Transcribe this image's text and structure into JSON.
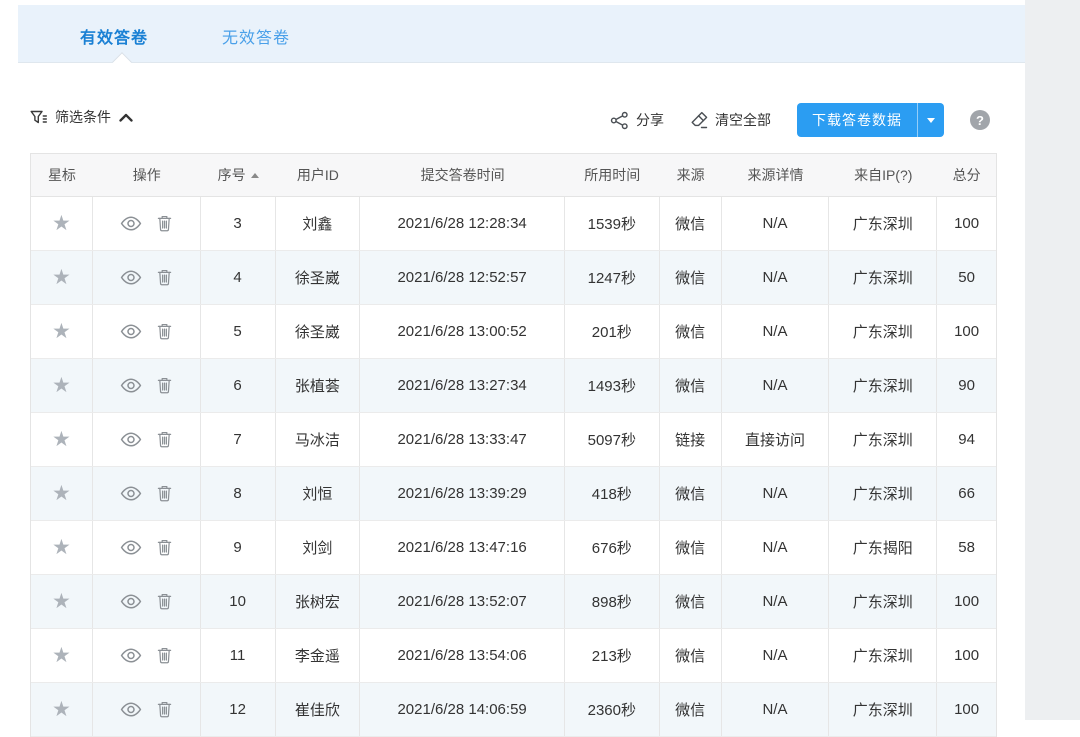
{
  "tabs": {
    "valid": "有效答卷",
    "invalid": "无效答卷"
  },
  "toolbar": {
    "filter": "筛选条件",
    "share": "分享",
    "clear_all": "清空全部",
    "download": "下载答卷数据",
    "help": "?"
  },
  "icons": {
    "star": "★"
  },
  "colors": {
    "accent": "#2b9df2",
    "active_tab": "#1a80d4",
    "inactive_tab": "#4aa0e9",
    "tabbar_bg": "#e9f2fb",
    "stripe": "#f2f7fa"
  },
  "table": {
    "headers": [
      "星标",
      "操作",
      "序号",
      "用户ID",
      "提交答卷时间",
      "所用时间",
      "来源",
      "来源详情",
      "来自IP(?)",
      "总分"
    ],
    "sorted_column": "序号",
    "sort_direction": "asc",
    "rows": [
      {
        "seq": "3",
        "user": "刘鑫",
        "time": "2021/6/28 12:28:34",
        "duration": "1539秒",
        "source": "微信",
        "source_detail": "N/A",
        "ip": "广东深圳",
        "score": "100"
      },
      {
        "seq": "4",
        "user": "徐圣崴",
        "time": "2021/6/28 12:52:57",
        "duration": "1247秒",
        "source": "微信",
        "source_detail": "N/A",
        "ip": "广东深圳",
        "score": "50"
      },
      {
        "seq": "5",
        "user": "徐圣崴",
        "time": "2021/6/28 13:00:52",
        "duration": "201秒",
        "source": "微信",
        "source_detail": "N/A",
        "ip": "广东深圳",
        "score": "100"
      },
      {
        "seq": "6",
        "user": "张植荟",
        "time": "2021/6/28 13:27:34",
        "duration": "1493秒",
        "source": "微信",
        "source_detail": "N/A",
        "ip": "广东深圳",
        "score": "90"
      },
      {
        "seq": "7",
        "user": "马冰洁",
        "time": "2021/6/28 13:33:47",
        "duration": "5097秒",
        "source": "链接",
        "source_detail": "直接访问",
        "ip": "广东深圳",
        "score": "94"
      },
      {
        "seq": "8",
        "user": "刘恒",
        "time": "2021/6/28 13:39:29",
        "duration": "418秒",
        "source": "微信",
        "source_detail": "N/A",
        "ip": "广东深圳",
        "score": "66"
      },
      {
        "seq": "9",
        "user": "刘剑",
        "time": "2021/6/28 13:47:16",
        "duration": "676秒",
        "source": "微信",
        "source_detail": "N/A",
        "ip": "广东揭阳",
        "score": "58"
      },
      {
        "seq": "10",
        "user": "张树宏",
        "time": "2021/6/28 13:52:07",
        "duration": "898秒",
        "source": "微信",
        "source_detail": "N/A",
        "ip": "广东深圳",
        "score": "100"
      },
      {
        "seq": "11",
        "user": "李金遥",
        "time": "2021/6/28 13:54:06",
        "duration": "213秒",
        "source": "微信",
        "source_detail": "N/A",
        "ip": "广东深圳",
        "score": "100"
      },
      {
        "seq": "12",
        "user": "崔佳欣",
        "time": "2021/6/28 14:06:59",
        "duration": "2360秒",
        "source": "微信",
        "source_detail": "N/A",
        "ip": "广东深圳",
        "score": "100"
      }
    ]
  }
}
